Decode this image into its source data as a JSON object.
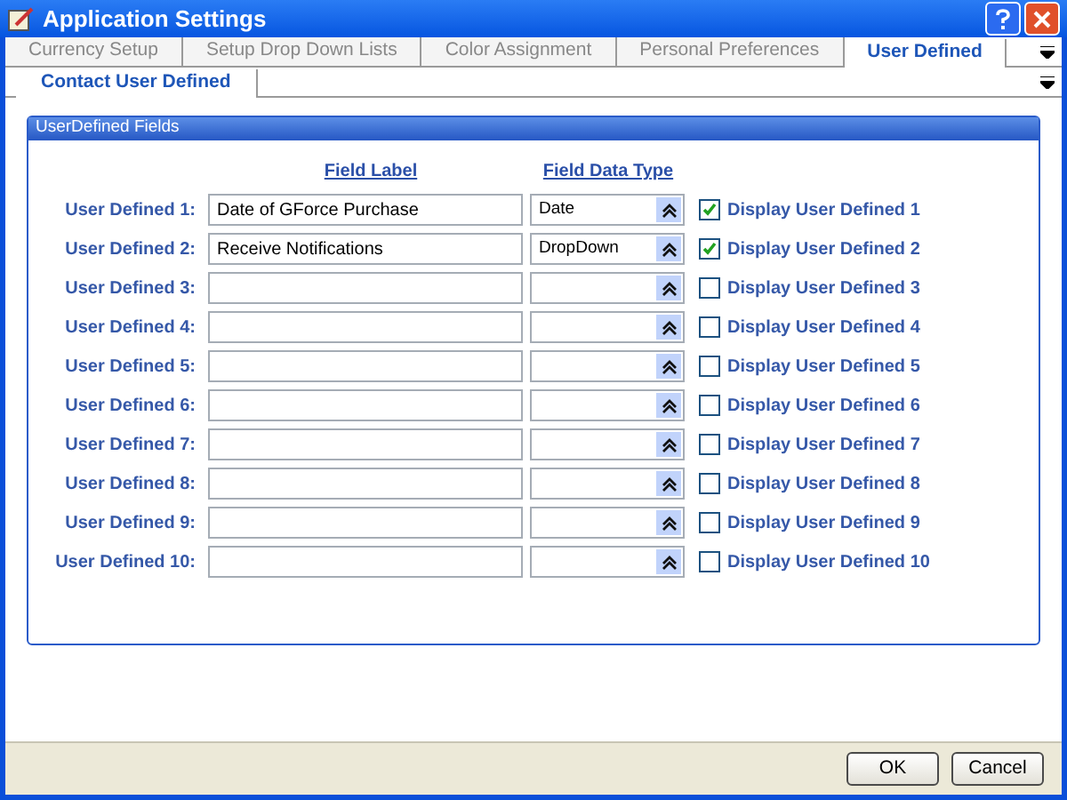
{
  "window": {
    "title": "Application Settings"
  },
  "tabs": [
    {
      "label": "Currency Setup",
      "selected": false
    },
    {
      "label": "Setup Drop Down Lists",
      "selected": false
    },
    {
      "label": "Color Assignment",
      "selected": false
    },
    {
      "label": "Personal Preferences",
      "selected": false
    },
    {
      "label": "User Defined",
      "selected": true
    }
  ],
  "subtabs": [
    {
      "label": "Contact User Defined",
      "selected": true
    }
  ],
  "panel": {
    "title": "UserDefined Fields",
    "column_headers": [
      "Field Label",
      "Field Data Type"
    ],
    "rows": [
      {
        "label": "User Defined 1:",
        "value": "Date of GForce Purchase",
        "type": "Date",
        "display": "Display User Defined 1",
        "checked": true
      },
      {
        "label": "User Defined 2:",
        "value": "Receive Notifications",
        "type": "DropDown",
        "display": "Display User Defined 2",
        "checked": true
      },
      {
        "label": "User Defined 3:",
        "display": "Display User Defined 3",
        "checked": false
      },
      {
        "label": "User Defined 4:",
        "display": "Display User Defined 4",
        "checked": false
      },
      {
        "label": "User Defined 5:",
        "display": "Display User Defined 5",
        "checked": false
      },
      {
        "label": "User Defined 6:",
        "display": "Display User Defined 6",
        "checked": false
      },
      {
        "label": "User Defined 7:",
        "display": "Display User Defined 7",
        "checked": false
      },
      {
        "label": "User Defined 8:",
        "display": "Display User Defined 8",
        "checked": false
      },
      {
        "label": "User Defined 9:",
        "display": "Display User Defined 9",
        "checked": false
      },
      {
        "label": "User Defined 10:",
        "display": "Display User Defined 10",
        "checked": false
      }
    ]
  },
  "buttons": [
    "OK",
    "Cancel"
  ]
}
